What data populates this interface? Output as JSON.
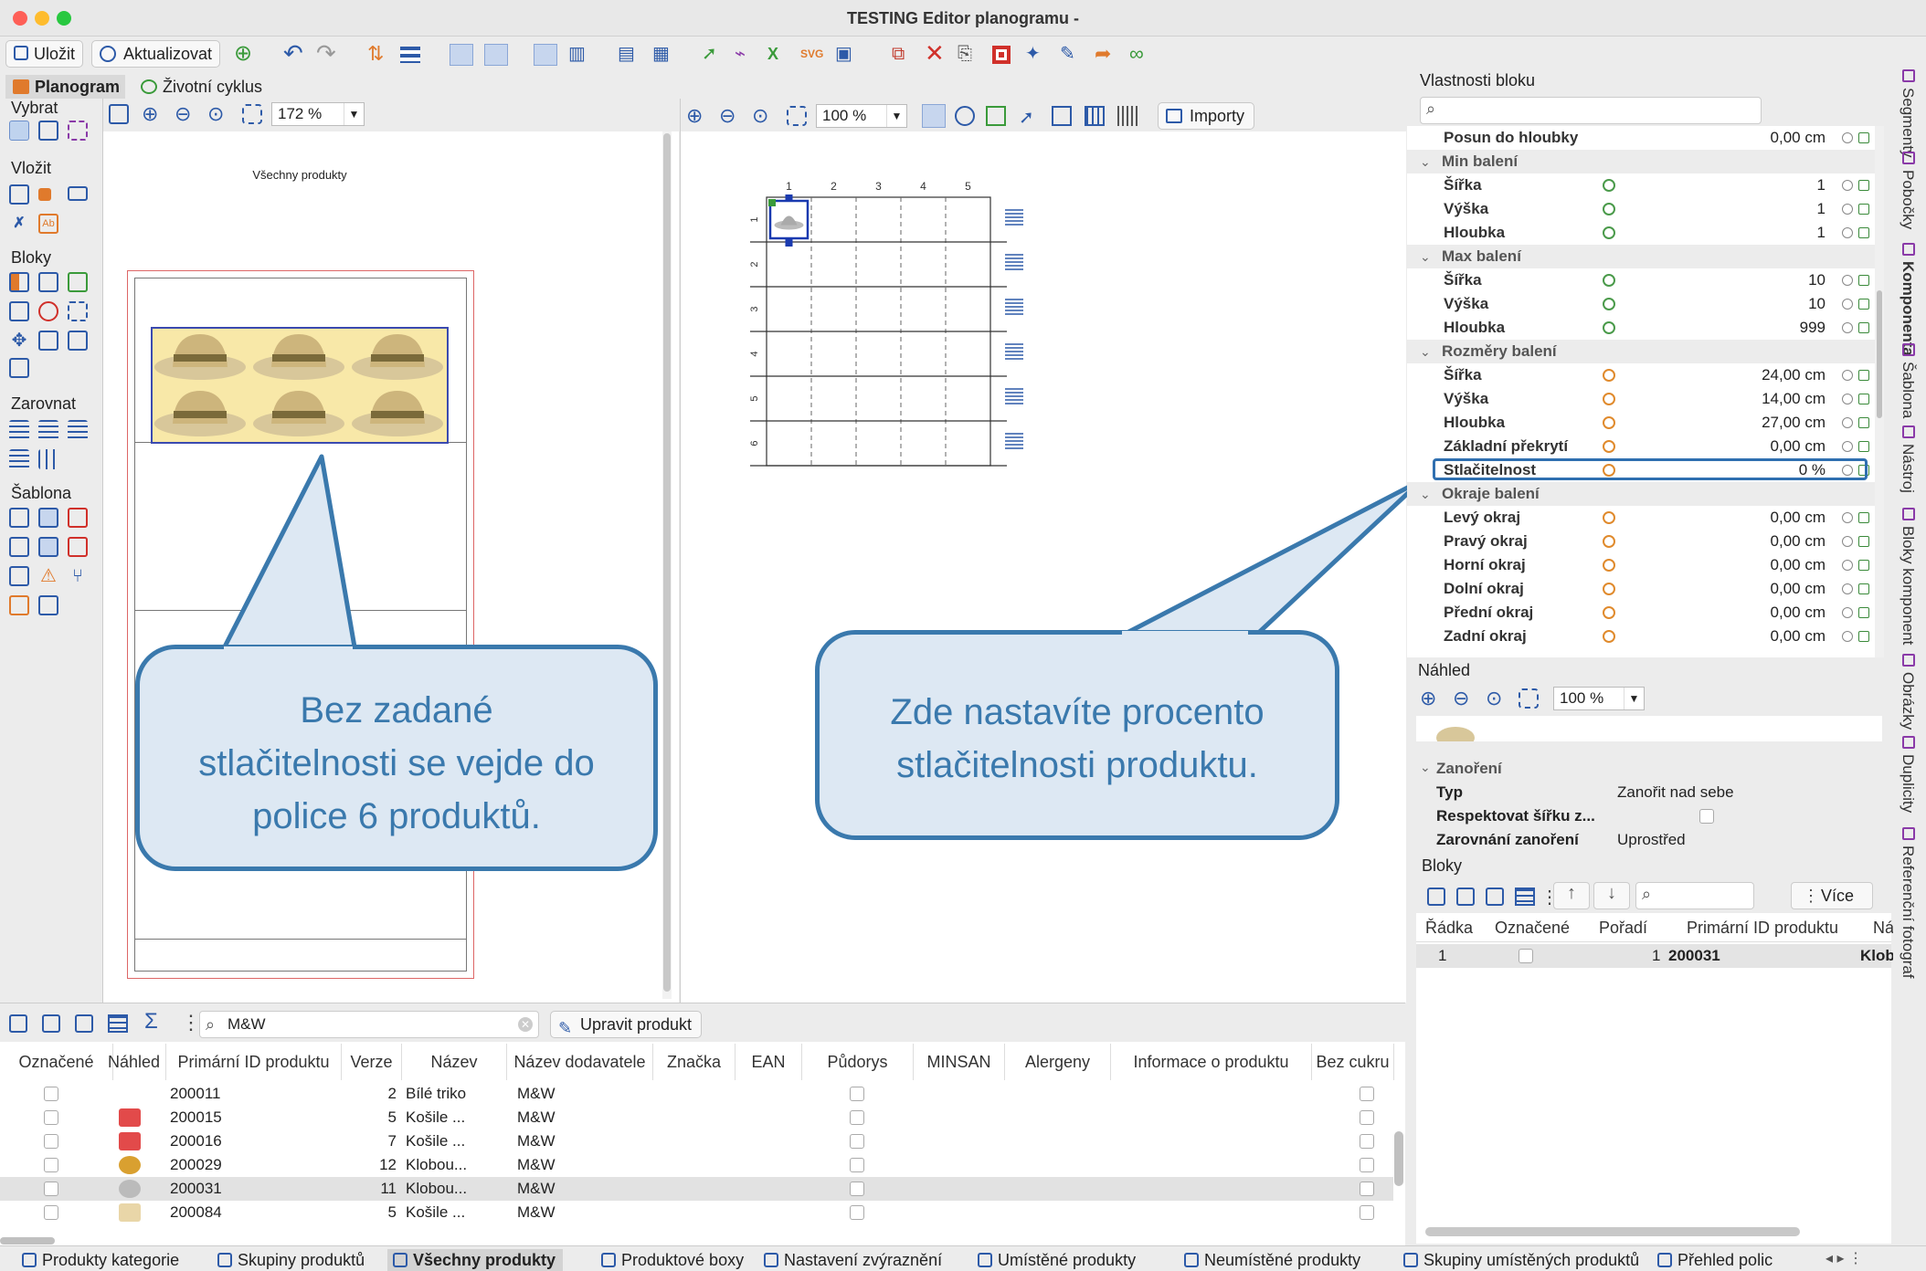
{
  "window": {
    "title": "TESTING Editor planogramu -"
  },
  "toolbar": {
    "save_label": "Uložit",
    "refresh_label": "Aktualizovat"
  },
  "tabs": [
    {
      "label": "Planogram"
    },
    {
      "label": "Životní cyklus"
    }
  ],
  "palette": {
    "select": "Vybrat",
    "insert": "Vložit",
    "blocks": "Bloky",
    "align": "Zarovnat",
    "template": "Šablona"
  },
  "left_view": {
    "zoom": "172 %",
    "heading": "Všechny produkty"
  },
  "right_view": {
    "zoom": "100 %",
    "imports_label": "Importy",
    "col_labels": [
      "1",
      "2",
      "3",
      "4",
      "5"
    ],
    "row_labels": [
      "1",
      "2",
      "3",
      "4",
      "5",
      "6"
    ]
  },
  "callouts": {
    "left": [
      "Bez zadané",
      "stlačitelnosti se vejde do",
      "police 6 produktů."
    ],
    "right": [
      "Zde nastavíte procento",
      "stlačitelnosti produktu."
    ]
  },
  "properties": {
    "title": "Vlastnosti bloku",
    "rows": [
      {
        "type": "prop",
        "label": "Posun do hloubky",
        "value": "0,00 cm",
        "icon": ""
      },
      {
        "type": "group",
        "label": "Min balení"
      },
      {
        "type": "prop",
        "label": "Šířka",
        "value": "1",
        "icon": "green"
      },
      {
        "type": "prop",
        "label": "Výška",
        "value": "1",
        "icon": "green"
      },
      {
        "type": "prop",
        "label": "Hloubka",
        "value": "1",
        "icon": "green"
      },
      {
        "type": "group",
        "label": "Max balení"
      },
      {
        "type": "prop",
        "label": "Šířka",
        "value": "10",
        "icon": "green"
      },
      {
        "type": "prop",
        "label": "Výška",
        "value": "10",
        "icon": "green"
      },
      {
        "type": "prop",
        "label": "Hloubka",
        "value": "999",
        "icon": "green"
      },
      {
        "type": "group",
        "label": "Rozměry balení"
      },
      {
        "type": "prop",
        "label": "Šířka",
        "value": "24,00 cm",
        "icon": "orange"
      },
      {
        "type": "prop",
        "label": "Výška",
        "value": "14,00 cm",
        "icon": "orange"
      },
      {
        "type": "prop",
        "label": "Hloubka",
        "value": "27,00 cm",
        "icon": "orange"
      },
      {
        "type": "prop",
        "label": "Základní překrytí",
        "value": "0,00 cm",
        "icon": "orange"
      },
      {
        "type": "prop",
        "label": "Stlačitelnost",
        "value": "0 %",
        "icon": "orange",
        "highlight": true
      },
      {
        "type": "group",
        "label": "Okraje balení"
      },
      {
        "type": "prop",
        "label": "Levý okraj",
        "value": "0,00 cm",
        "icon": "orange"
      },
      {
        "type": "prop",
        "label": "Pravý okraj",
        "value": "0,00 cm",
        "icon": "orange"
      },
      {
        "type": "prop",
        "label": "Horní okraj",
        "value": "0,00 cm",
        "icon": "orange"
      },
      {
        "type": "prop",
        "label": "Dolní okraj",
        "value": "0,00 cm",
        "icon": "orange"
      },
      {
        "type": "prop",
        "label": "Přední okraj",
        "value": "0,00 cm",
        "icon": "orange"
      },
      {
        "type": "prop",
        "label": "Zadní okraj",
        "value": "0,00 cm",
        "icon": "orange"
      }
    ]
  },
  "preview": {
    "title": "Náhled",
    "zoom": "100 %"
  },
  "nesting": {
    "group": "Zanoření",
    "type_label": "Typ",
    "type_value": "Zanořit nad sebe",
    "respect_label": "Respektovat šířku z...",
    "align_label": "Zarovnání zanoření",
    "align_value": "Uprostřed"
  },
  "blocks": {
    "title": "Bloky",
    "more_label": "Více",
    "columns": [
      "Řádka",
      "Označené",
      "Pořadí",
      "Primární ID produktu",
      "Ná"
    ],
    "rows": [
      {
        "row": "1",
        "order": "1",
        "id": "200031",
        "name": "Klob"
      }
    ]
  },
  "products": {
    "search_value": "M&W",
    "edit_label": "Upravit produkt",
    "columns": [
      "Označené",
      "Náhled",
      "Primární ID produktu",
      "Verze",
      "Název",
      "Název dodavatele",
      "Značka",
      "EAN",
      "Půdorys",
      "MINSAN",
      "Alergeny",
      "Informace o produktu",
      "Bez cukru"
    ],
    "rows": [
      {
        "id": "200011",
        "ver": "2",
        "name": "Bílé triko",
        "supplier": "M&W"
      },
      {
        "id": "200015",
        "ver": "5",
        "name": "Košile ...",
        "supplier": "M&W"
      },
      {
        "id": "200016",
        "ver": "7",
        "name": "Košile ...",
        "supplier": "M&W"
      },
      {
        "id": "200029",
        "ver": "12",
        "name": "Klobou...",
        "supplier": "M&W"
      },
      {
        "id": "200031",
        "ver": "11",
        "name": "Klobou...",
        "supplier": "M&W"
      },
      {
        "id": "200084",
        "ver": "5",
        "name": "Košile ...",
        "supplier": "M&W"
      }
    ]
  },
  "side_tabs": [
    "Segmenty",
    "Pobočky",
    "Komponenta",
    "Šablona",
    "Nástroj",
    "Bloky komponent",
    "Obrázky",
    "Duplicity",
    "Referenční fotograf"
  ],
  "status_tabs": [
    "Produkty kategorie",
    "Skupiny produktů",
    "Všechny produkty",
    "Produktové boxy",
    "Nastavení zvýraznění",
    "Umístěné produkty",
    "Neumístěné produkty",
    "Skupiny umístěných produktů",
    "Přehled polic"
  ]
}
